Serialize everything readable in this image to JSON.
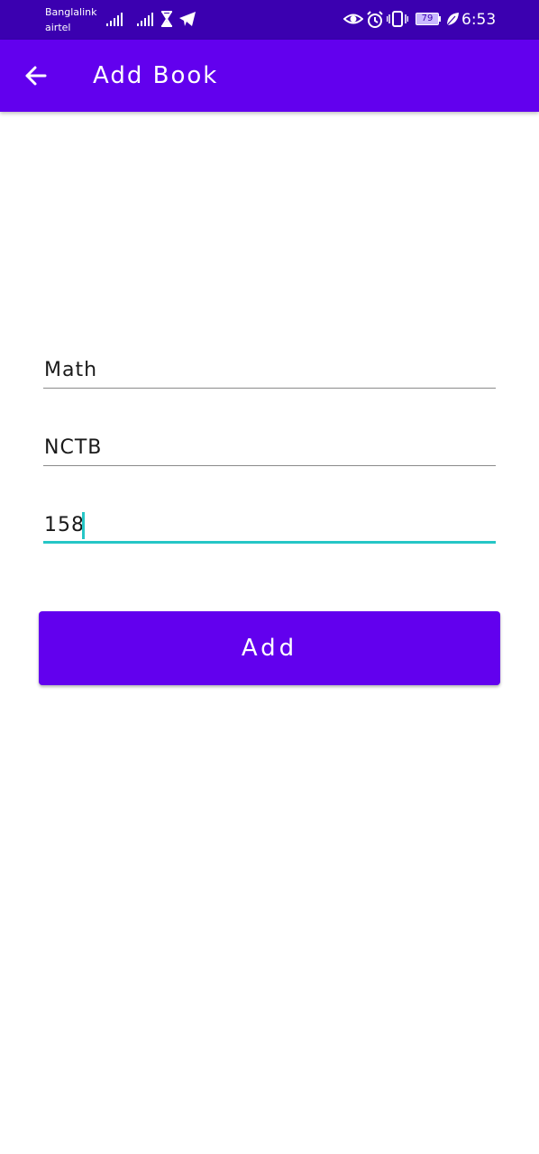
{
  "status_bar": {
    "carrier_1": "Banglalink",
    "carrier_2": "airtel",
    "battery": "79",
    "time": "6:53",
    "icons": [
      "signal-bars-icon",
      "signal-bars-icon",
      "hourglass-icon",
      "telegram-icon",
      "eye-icon",
      "alarm-icon",
      "vibrate-icon",
      "battery-icon",
      "leaf-icon"
    ]
  },
  "app_bar": {
    "back_icon": "arrow-back-icon",
    "title": "Add Book",
    "color": "#6200ee"
  },
  "form": {
    "fields": [
      {
        "value": "Math"
      },
      {
        "value": "NCTB"
      },
      {
        "value": "158",
        "focused": true
      }
    ],
    "focus_color": "#26c6c6"
  },
  "actions": {
    "add_label": "Add"
  }
}
